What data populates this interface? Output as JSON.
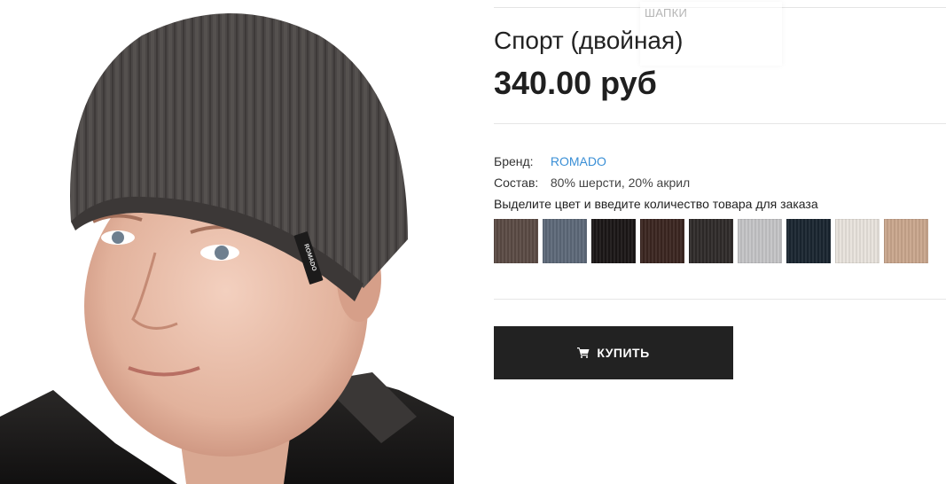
{
  "breadcrumb": {
    "category": "ШАПКИ"
  },
  "product": {
    "title": "Спорт (двойная)",
    "price": "340.00 руб",
    "brand_label": "Бренд:",
    "brand_value": "ROMADO",
    "composition_label": "Состав:",
    "composition_value": "80% шерсти, 20% акрил",
    "color_instruction": "Выделите цвет и введите количество товара для заказа",
    "hat_tag_text": "ROMADO"
  },
  "swatches": [
    {
      "name": "brown",
      "color": "#5a4a44"
    },
    {
      "name": "blue-grey",
      "color": "#5c6878"
    },
    {
      "name": "black",
      "color": "#1b1616"
    },
    {
      "name": "dark-brown",
      "color": "#3a2520"
    },
    {
      "name": "charcoal",
      "color": "#2f2b29"
    },
    {
      "name": "light-grey",
      "color": "#c4c4c6"
    },
    {
      "name": "navy",
      "color": "#1a2530"
    },
    {
      "name": "cream",
      "color": "#e8e2dc"
    },
    {
      "name": "beige",
      "color": "#c9a68c"
    }
  ],
  "actions": {
    "buy_label": "КУПИТЬ",
    "buy_icon": "shopping-cart-icon"
  },
  "colors": {
    "button_bg": "#222222",
    "link": "#3a8fd6",
    "hat": "#4a4645"
  }
}
